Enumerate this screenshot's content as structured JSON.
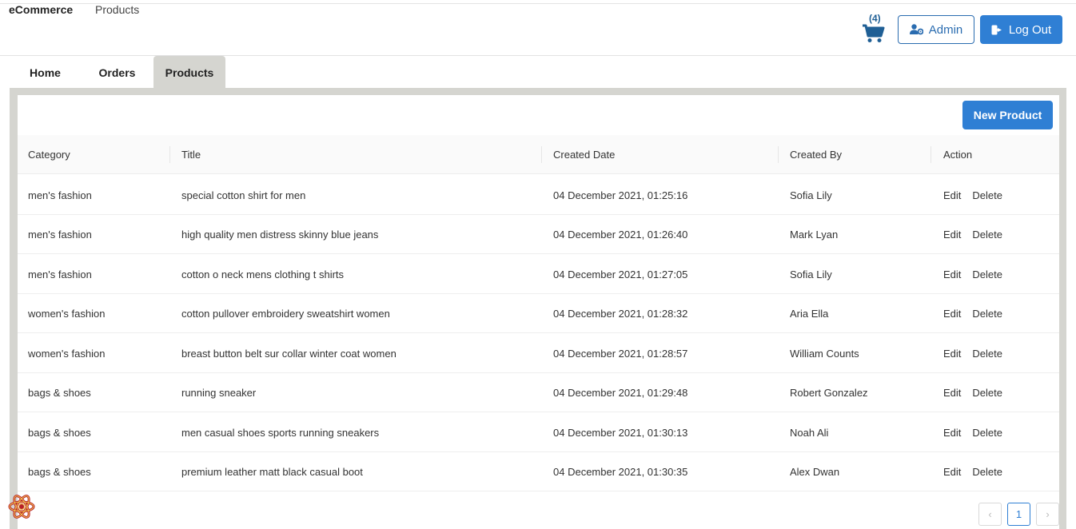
{
  "header": {
    "brand": "eCommerce",
    "breadcrumb": "Products",
    "cart_count": "(4)",
    "admin_label": "Admin",
    "logout_label": "Log Out"
  },
  "tabs": [
    {
      "label": "Home"
    },
    {
      "label": "Orders"
    },
    {
      "label": "Products",
      "active": true
    }
  ],
  "toolbar": {
    "new_product_label": "New Product"
  },
  "table": {
    "columns": [
      "Category",
      "Title",
      "Created Date",
      "Created By",
      "Action"
    ],
    "rows": [
      {
        "category": "men's fashion",
        "title": "special cotton shirt for men",
        "date": "04 December 2021, 01:25:16",
        "by": "Sofia Lily",
        "edit": "Edit",
        "delete": "Delete"
      },
      {
        "category": "men's fashion",
        "title": "high quality men distress skinny blue jeans",
        "date": "04 December 2021, 01:26:40",
        "by": "Mark Lyan",
        "edit": "Edit",
        "delete": "Delete"
      },
      {
        "category": "men's fashion",
        "title": "cotton o neck mens clothing t shirts",
        "date": "04 December 2021, 01:27:05",
        "by": "Sofia Lily",
        "edit": "Edit",
        "delete": "Delete"
      },
      {
        "category": "women's fashion",
        "title": "cotton pullover embroidery sweatshirt women",
        "date": "04 December 2021, 01:28:32",
        "by": "Aria Ella",
        "edit": "Edit",
        "delete": "Delete"
      },
      {
        "category": "women's fashion",
        "title": "breast button belt sur collar winter coat women",
        "date": "04 December 2021, 01:28:57",
        "by": "William Counts",
        "edit": "Edit",
        "delete": "Delete"
      },
      {
        "category": "bags & shoes",
        "title": "running sneaker",
        "date": "04 December 2021, 01:29:48",
        "by": "Robert Gonzalez",
        "edit": "Edit",
        "delete": "Delete"
      },
      {
        "category": "bags & shoes",
        "title": "men casual shoes sports running sneakers",
        "date": "04 December 2021, 01:30:13",
        "by": "Noah Ali",
        "edit": "Edit",
        "delete": "Delete"
      },
      {
        "category": "bags & shoes",
        "title": "premium leather matt black casual boot",
        "date": "04 December 2021, 01:30:35",
        "by": "Alex Dwan",
        "edit": "Edit",
        "delete": "Delete"
      }
    ]
  },
  "pagination": {
    "prev": "‹",
    "current": "1",
    "next": "›"
  },
  "icons": {
    "cart": "shopping-cart-icon",
    "admin": "user-gear-icon",
    "logout": "sign-out-icon",
    "devtools": "react-logo-icon"
  },
  "colors": {
    "primary": "#2f7fd4",
    "cart": "#1f5f95",
    "frame": "#d5d5d0"
  }
}
